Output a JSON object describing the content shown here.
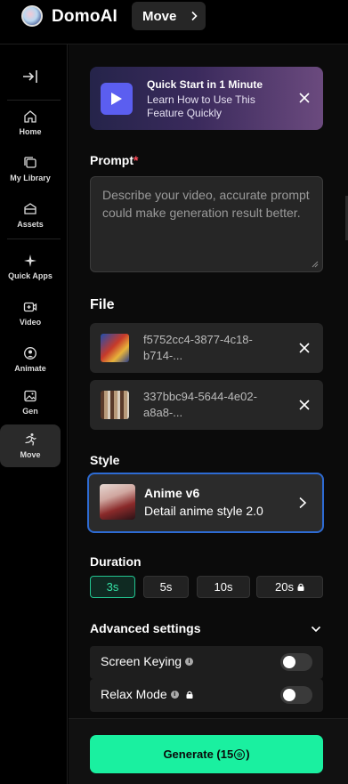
{
  "app": {
    "brand": "DomoAI",
    "current_page": "Move"
  },
  "sidebar": {
    "items": [
      {
        "label": "Home",
        "icon": "home-icon"
      },
      {
        "label": "My Library",
        "icon": "library-icon"
      },
      {
        "label": "Assets",
        "icon": "assets-icon"
      },
      {
        "label": "Quick Apps",
        "icon": "sparkle-icon"
      },
      {
        "label": "Video",
        "icon": "video-plus-icon"
      },
      {
        "label": "Animate",
        "icon": "animate-icon"
      },
      {
        "label": "Gen",
        "icon": "image-icon"
      },
      {
        "label": "Move",
        "icon": "running-person-icon",
        "active": true
      }
    ]
  },
  "banner": {
    "title": "Quick Start in 1 Minute",
    "subtitle": "Learn How to Use This Feature Quickly"
  },
  "prompt": {
    "label": "Prompt",
    "required_mark": "*",
    "placeholder": "Describe your video, accurate prompt could make generation result better.",
    "value": ""
  },
  "file": {
    "label": "File",
    "items": [
      {
        "name": "f5752cc4-3877-4c18-b714-..."
      },
      {
        "name": "337bbc94-5644-4e02-a8a8-..."
      }
    ]
  },
  "style": {
    "label": "Style",
    "selected_name": "Anime v6",
    "selected_description": "Detail anime style 2.0"
  },
  "duration": {
    "label": "Duration",
    "options": [
      {
        "label": "3s",
        "selected": true,
        "locked": false
      },
      {
        "label": "5s",
        "selected": false,
        "locked": false
      },
      {
        "label": "10s",
        "selected": false,
        "locked": false
      },
      {
        "label": "20s",
        "selected": false,
        "locked": true
      }
    ]
  },
  "advanced": {
    "label": "Advanced settings",
    "settings": [
      {
        "label": "Screen Keying",
        "on": false,
        "locked": false
      },
      {
        "label": "Relax Mode",
        "on": false,
        "locked": true
      }
    ]
  },
  "generate": {
    "label": "Generate (15",
    "cost_suffix": ")"
  },
  "colors": {
    "accent": "#1af0a0",
    "selected_border": "#2d6bd3",
    "banner_play": "#5b5ef0"
  }
}
